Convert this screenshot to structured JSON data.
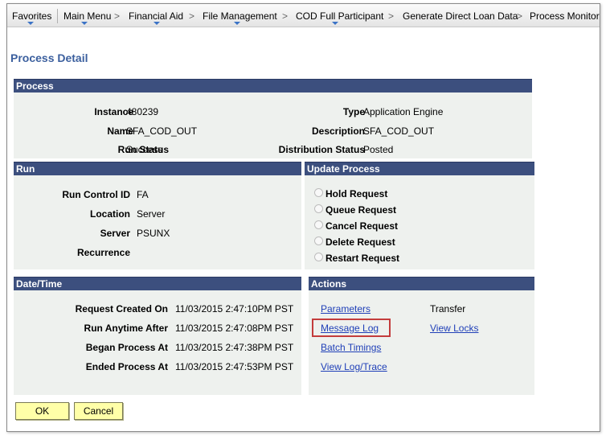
{
  "nav": {
    "items": [
      "Favorites",
      "Main Menu",
      "Financial Aid",
      "File Management",
      "COD Full Participant",
      "Generate Direct Loan Data",
      "Process Monitor"
    ],
    "separator": ">"
  },
  "page_title": "Process Detail",
  "process": {
    "header": "Process",
    "instance_label": "Instance",
    "instance_value": "480239",
    "name_label": "Name",
    "name_value": "SFA_COD_OUT",
    "run_status_label": "Run Status",
    "run_status_value": "Success",
    "type_label": "Type",
    "type_value": "Application Engine",
    "description_label": "Description",
    "description_value": "SFA_COD_OUT",
    "distribution_status_label": "Distribution Status",
    "distribution_status_value": "Posted"
  },
  "run": {
    "header": "Run",
    "run_control_label": "Run Control ID",
    "run_control_value": "FA",
    "location_label": "Location",
    "location_value": "Server",
    "server_label": "Server",
    "server_value": "PSUNX",
    "recurrence_label": "Recurrence",
    "recurrence_value": ""
  },
  "update_process": {
    "header": "Update Process",
    "options": [
      "Hold Request",
      "Queue Request",
      "Cancel Request",
      "Delete Request",
      "Restart Request"
    ]
  },
  "datetime": {
    "header": "Date/Time",
    "request_created_label": "Request Created On",
    "request_created_value": "11/03/2015  2:47:10PM PST",
    "run_anytime_label": "Run Anytime After",
    "run_anytime_value": "11/03/2015  2:47:08PM PST",
    "began_label": "Began Process At",
    "began_value": "11/03/2015  2:47:38PM PST",
    "ended_label": "Ended Process At",
    "ended_value": "11/03/2015  2:47:53PM PST"
  },
  "actions": {
    "header": "Actions",
    "parameters": "Parameters",
    "transfer": "Transfer",
    "message_log": "Message Log",
    "view_locks": "View Locks",
    "batch_timings": "Batch Timings",
    "view_log_trace": "View Log/Trace"
  },
  "buttons": {
    "ok": "OK",
    "cancel": "Cancel"
  },
  "colors": {
    "section_header": "#3c4f7e",
    "section_body": "#eef1ee",
    "title": "#3b5f9e",
    "link": "#2040b8",
    "button": "#ffffa8",
    "highlight": "#c33c3c"
  }
}
